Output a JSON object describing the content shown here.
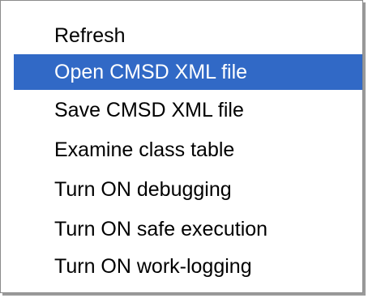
{
  "context_menu": {
    "items": [
      {
        "label": "Refresh",
        "highlighted": false
      },
      {
        "label": "Open CMSD XML file",
        "highlighted": true
      },
      {
        "label": "Save CMSD XML file",
        "highlighted": false
      },
      {
        "label": "Examine class table",
        "highlighted": false
      },
      {
        "label": "Turn ON debugging",
        "highlighted": false
      },
      {
        "label": "Turn ON safe execution",
        "highlighted": false
      },
      {
        "label": "Turn ON work-logging",
        "highlighted": false
      }
    ],
    "colors": {
      "highlight_background": "#3169c6",
      "highlight_text": "#ffffff",
      "text": "#000000",
      "background": "#ffffff"
    }
  }
}
